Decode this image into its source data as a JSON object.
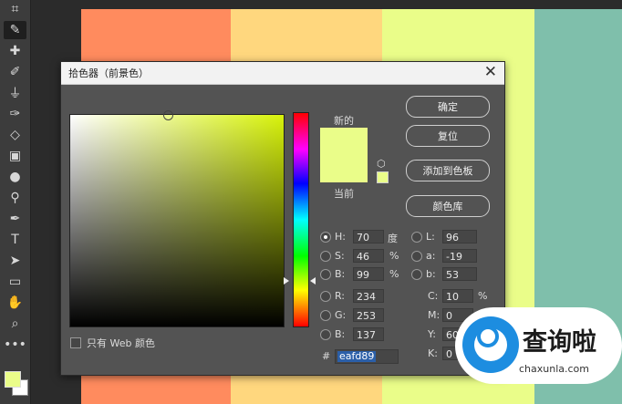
{
  "toolbar": {
    "tools": [
      "crop-icon",
      "eyedropper-icon",
      "healing-brush-icon",
      "brush-icon",
      "clone-stamp-icon",
      "history-brush-icon",
      "eraser-icon",
      "gradient-icon",
      "blur-icon",
      "dodge-icon",
      "pen-icon",
      "type-icon",
      "path-select-icon",
      "rectangle-icon",
      "hand-icon",
      "zoom-icon",
      "more-icon"
    ],
    "tool_glyphs": [
      "⌗",
      "✎",
      "✚",
      "✐",
      "⏚",
      "✑",
      "◇",
      "▣",
      "●",
      "⚲",
      "✒",
      "T",
      "➤",
      "▭",
      "✋",
      "⌕",
      "•••"
    ],
    "foreground_color": "#eafd89",
    "background_color": "#ffffff"
  },
  "canvas": {
    "stripes": [
      "#ff8b5e",
      "#ffd77e",
      "#eafd89",
      "#7fbfab"
    ]
  },
  "dialog": {
    "title": "拾色器（前景色）",
    "close_glyph": "✕",
    "new_label": "新的",
    "current_label": "当前",
    "new_color": "#eafd89",
    "current_color": "#eafd89",
    "buttons": {
      "ok": "确定",
      "reset": "复位",
      "add_to_swatches": "添加到色板",
      "color_libraries": "颜色库"
    },
    "hsb": {
      "h_label": "H:",
      "h_value": "70",
      "h_unit": "度",
      "s_label": "S:",
      "s_value": "46",
      "s_unit": "%",
      "b_label": "B:",
      "b_value": "99",
      "b_unit": "%"
    },
    "lab": {
      "l_label": "L:",
      "l_value": "96",
      "a_label": "a:",
      "a_value": "-19",
      "b_label": "b:",
      "b_value": "53"
    },
    "rgb": {
      "r_label": "R:",
      "r_value": "234",
      "g_label": "G:",
      "g_value": "253",
      "b_label": "B:",
      "b_value": "137"
    },
    "cmyk": {
      "c_label": "C:",
      "c_value": "10",
      "c_unit": "%",
      "m_label": "M:",
      "m_value": "0",
      "m_unit": "%",
      "y_label": "Y:",
      "y_value": "60",
      "k_label": "K:",
      "k_value": "0"
    },
    "hex_label": "#",
    "hex_value": "eafd89",
    "web_only_label": "只有 Web 颜色"
  },
  "watermark": {
    "name": "查询啦",
    "url": "chaxunla.com"
  }
}
